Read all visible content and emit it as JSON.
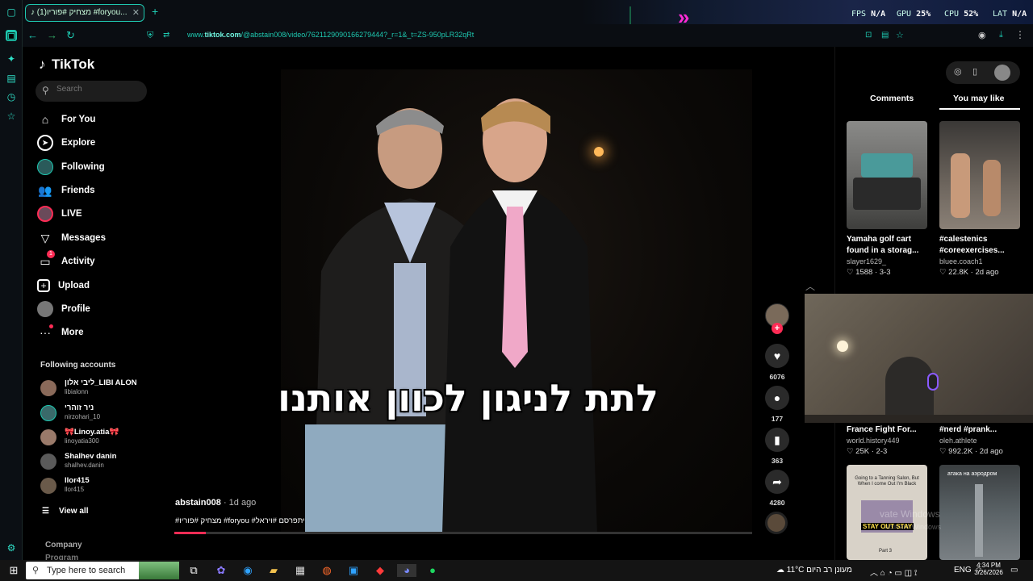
{
  "browser": {
    "tab_title": "(1)מצחיק #פוריו #foryou...",
    "url_prefix": "www.",
    "url_domain": "tiktok.com",
    "url_rest": "/@abstain008/video/7621129090166279444?_r=1&_t=ZS-950pLR32qRt"
  },
  "hud": {
    "fps_label": "FPS",
    "fps": "N/A",
    "gpu_label": "GPU",
    "gpu": "25%",
    "cpu_label": "CPU",
    "cpu": "52%",
    "lat_label": "LAT",
    "lat": "N/A"
  },
  "sidebar": {
    "logo": "TikTok",
    "search_placeholder": "Search",
    "nav": [
      {
        "label": "For You"
      },
      {
        "label": "Explore"
      },
      {
        "label": "Following"
      },
      {
        "label": "Friends"
      },
      {
        "label": "LIVE"
      },
      {
        "label": "Messages"
      },
      {
        "label": "Activity",
        "badge": "1"
      },
      {
        "label": "Upload"
      },
      {
        "label": "Profile"
      },
      {
        "label": "More"
      }
    ],
    "following_title": "Following accounts",
    "accounts": [
      {
        "name": "ליבי אלון_LIBI ALON",
        "handle": "libialonn"
      },
      {
        "name": "ניר זוהרי",
        "handle": "nirzohari_10"
      },
      {
        "name": "🎀Linoy.atia🎀",
        "handle": "linoyatia300"
      },
      {
        "name": "Shalhev danin",
        "handle": "shalhev.danin"
      },
      {
        "name": "llor415",
        "handle": "llor415"
      }
    ],
    "view_all": "View all",
    "company": "Company",
    "program": "Program"
  },
  "video": {
    "caption": "לתת לניגון לכוון אותנו",
    "author": "abstain008",
    "age": "· 1d ago",
    "hashtags": "#מצחיק #פוריו #foryou #יתפרסם #ויראל",
    "progress": 0.055
  },
  "actions": {
    "likes": "6076",
    "comments": "177",
    "saves": "363",
    "shares": "4280"
  },
  "right_panel": {
    "tab_comments": "Comments",
    "tab_may_like": "You may like",
    "cards": [
      {
        "title": "Yamaha golf cart found in a storag...",
        "author": "slayer1629_",
        "likes": "1588",
        "date": "3-3"
      },
      {
        "title": "#calestenics #coreexercises...",
        "author": "bluee.coach1",
        "likes": "22.8K",
        "date": "2d ago"
      },
      {
        "title": "France Fight For...",
        "author": "world.history449",
        "likes": "25K",
        "date": "2-3"
      },
      {
        "title": "#nerd #prank...",
        "author": "oleh.athlete",
        "likes": "992.2K",
        "date": "2d ago"
      }
    ],
    "card5_text": "Going to a Tanning Salon, But When I come Out I'm Black",
    "card5_sticker": "STAY OUT STAY",
    "card5_part": "Part 3",
    "card6_text": "атака на аэродром",
    "watermark1": "vate Windows",
    "watermark2": "activate Windows"
  },
  "taskbar": {
    "search_placeholder": "Type here to search",
    "weather": "11°C",
    "weather_text": "מעונן רב היום",
    "lang": "ENG",
    "time": "4:34 PM",
    "date": "3/26/2026"
  }
}
